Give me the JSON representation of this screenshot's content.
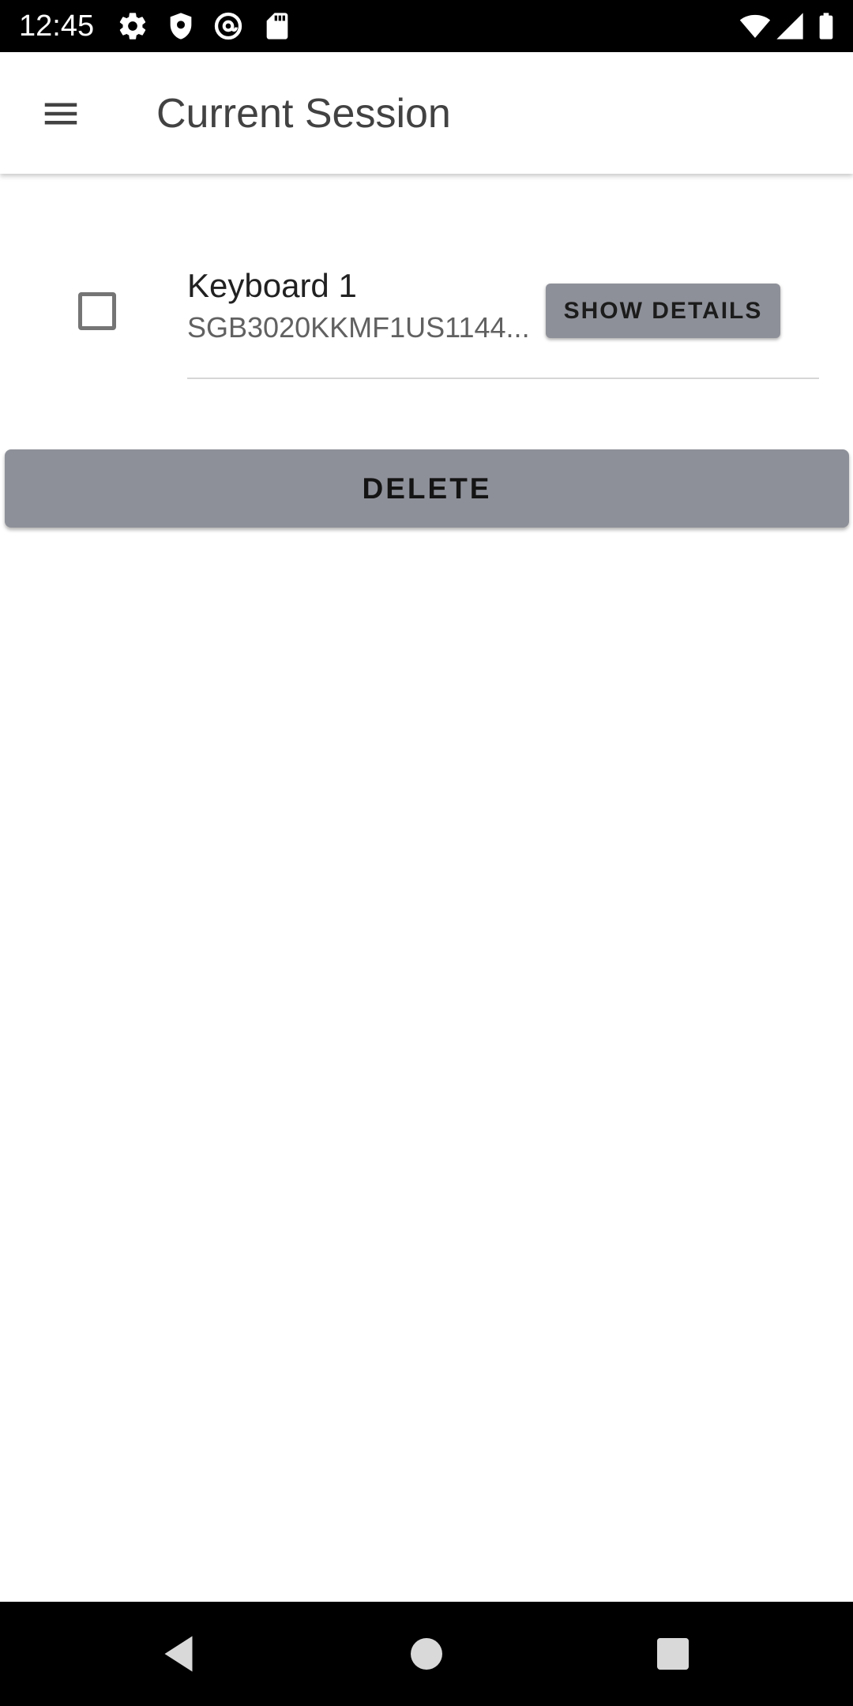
{
  "status_bar": {
    "time": "12:45",
    "icons_left": [
      "gear-icon",
      "shield-icon",
      "at-sign-icon",
      "sd-card-icon"
    ],
    "icons_right": [
      "wifi-icon",
      "signal-icon",
      "battery-icon"
    ]
  },
  "app_bar": {
    "title": "Current Session",
    "menu_icon": "menu-icon"
  },
  "devices": [
    {
      "name": "Keyboard 1",
      "serial": "SGB3020KKMF1US1144...",
      "checked": false,
      "details_label": "SHOW DETAILS"
    }
  ],
  "actions": {
    "delete_label": "DELETE"
  },
  "colors": {
    "button_gray": "#8e9099",
    "status_bar": "#000000",
    "title_text": "#424242"
  },
  "nav_bar": {
    "icons": [
      "back-icon",
      "home-icon",
      "recents-icon"
    ]
  }
}
